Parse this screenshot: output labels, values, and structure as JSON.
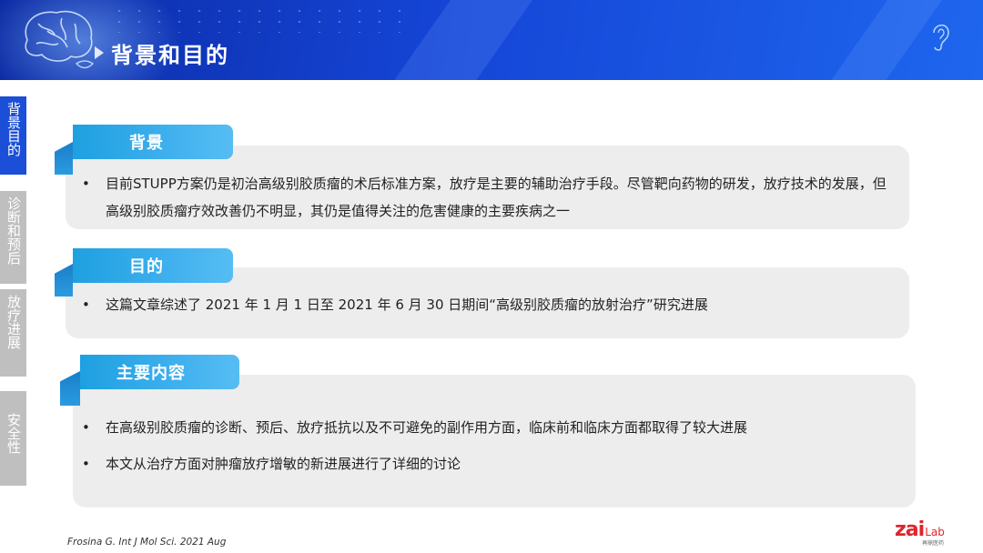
{
  "header": {
    "title": "背景和目的",
    "colors": {
      "primary": "#1545d6",
      "accent": "#3fb0ee",
      "nav_inactive": "#bfbfbf"
    },
    "icons": [
      "brain-icon",
      "lips-icon",
      "ear-icon"
    ]
  },
  "nav": {
    "items": [
      {
        "label": "背景目的",
        "active": true
      },
      {
        "label": "诊断和预后",
        "active": false
      },
      {
        "label": "放疗进展",
        "active": false
      },
      {
        "label": "安全性",
        "active": false
      }
    ]
  },
  "sections": [
    {
      "title": "背景",
      "bullets": [
        "目前STUPP方案仍是初治高级别胶质瘤的术后标准方案，放疗是主要的辅助治疗手段。尽管靶向药物的研发，放疗技术的发展，但高级别胶质瘤疗效改善仍不明显，其仍是值得关注的危害健康的主要疾病之一"
      ]
    },
    {
      "title": "目的",
      "bullets": [
        "这篇文章综述了 2021 年 1 月 1 日至 2021 年 6 月 30 日期间“高级别胶质瘤的放射治疗”研究进展"
      ]
    },
    {
      "title": "主要内容",
      "bullets": [
        "在高级别胶质瘤的诊断、预后、放疗抵抗以及不可避免的副作用方面，临床前和临床方面都取得了较大进展",
        "本文从治疗方面对肿瘤放疗增敏的新进展进行了详细的讨论"
      ]
    }
  ],
  "footer": {
    "citation": "Frosina G. Int J Mol Sci. 2021 Aug",
    "logo": {
      "main": "zai",
      "sub": "Lab",
      "cn": "再鼎医药"
    }
  }
}
